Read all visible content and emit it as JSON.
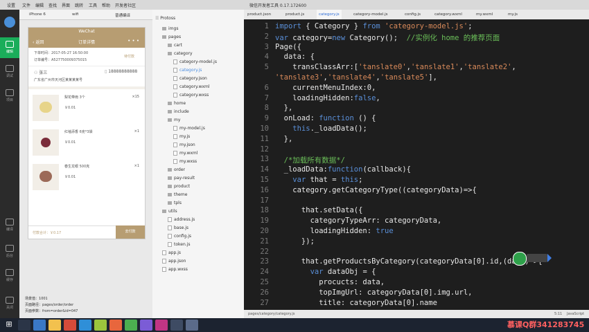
{
  "menubar": {
    "items": [
      "设置",
      "文件",
      "编辑",
      "查找",
      "界面",
      "跳转",
      "工具",
      "帮助",
      "开发者社区"
    ],
    "window_title": "微信开发者工具 0.17.172600"
  },
  "leftbar": {
    "items": [
      {
        "label": "编辑",
        "icon": "code-icon"
      },
      {
        "label": "调试",
        "icon": "bug-icon"
      },
      {
        "label": "项目",
        "icon": "project-icon"
      },
      {
        "label": "编译",
        "icon": "compile-icon"
      },
      {
        "label": "后台",
        "icon": "backend-icon"
      },
      {
        "label": "缓存",
        "icon": "cache-icon"
      },
      {
        "label": "关闭",
        "icon": "close-icon"
      }
    ]
  },
  "simulator": {
    "device": "iPhone 6",
    "network": "wifi",
    "mode": "普通编译",
    "status_title": "WeChat",
    "nav_back": "返回",
    "nav_title": "订单详情",
    "order_time_label": "下单时间：",
    "order_time": "2017-05-27 16:50:00",
    "order_no_label": "订单编号：",
    "order_no": "A527750009375015",
    "order_status": "待付款",
    "consignee": "张三",
    "phone": "18888888888",
    "address": "广东省广州市天河区某某某某号",
    "products": [
      {
        "name": "梨花带雨 3个",
        "price": "￥0.01",
        "count": "×15"
      },
      {
        "name": "红袖添香 6克*3袋",
        "price": "￥0.01",
        "count": "×1"
      },
      {
        "name": "春生龙眼 500克",
        "price": "￥0.01",
        "count": "×1"
      }
    ],
    "pay_total_label": "付款合计：",
    "pay_total": "￥0.17",
    "pay_button": "去付款",
    "page_info": [
      {
        "label": "场景值：",
        "value": "1001"
      },
      {
        "label": "页面路径：",
        "value": "pages/order/order"
      },
      {
        "label": "页面参数：",
        "value": "from=order&id=047"
      }
    ]
  },
  "filetree": {
    "project": "Protoss",
    "rows": [
      {
        "label": "imgs",
        "type": "folder",
        "level": 1
      },
      {
        "label": "pages",
        "type": "folder",
        "level": 1
      },
      {
        "label": "cart",
        "type": "folder",
        "level": 2
      },
      {
        "label": "category",
        "type": "folder",
        "level": 2
      },
      {
        "label": "category-model.js",
        "type": "file",
        "level": 3
      },
      {
        "label": "category.js",
        "type": "file",
        "level": 3,
        "active": true
      },
      {
        "label": "category.json",
        "type": "file",
        "level": 3
      },
      {
        "label": "category.wxml",
        "type": "file",
        "level": 3
      },
      {
        "label": "category.wxss",
        "type": "file",
        "level": 3
      },
      {
        "label": "home",
        "type": "folder",
        "level": 2
      },
      {
        "label": "include",
        "type": "folder",
        "level": 2
      },
      {
        "label": "my",
        "type": "folder",
        "level": 2
      },
      {
        "label": "my-model.js",
        "type": "file",
        "level": 3
      },
      {
        "label": "my.js",
        "type": "file",
        "level": 3
      },
      {
        "label": "my.json",
        "type": "file",
        "level": 3
      },
      {
        "label": "my.wxml",
        "type": "file",
        "level": 3
      },
      {
        "label": "my.wxss",
        "type": "file",
        "level": 3
      },
      {
        "label": "order",
        "type": "folder",
        "level": 2
      },
      {
        "label": "pay-result",
        "type": "folder",
        "level": 2
      },
      {
        "label": "product",
        "type": "folder",
        "level": 2
      },
      {
        "label": "theme",
        "type": "folder",
        "level": 2
      },
      {
        "label": "tpls",
        "type": "folder",
        "level": 2
      },
      {
        "label": "utils",
        "type": "folder",
        "level": 1
      },
      {
        "label": "address.js",
        "type": "file",
        "level": 2
      },
      {
        "label": "base.js",
        "type": "file",
        "level": 2
      },
      {
        "label": "config.js",
        "type": "file",
        "level": 2
      },
      {
        "label": "token.js",
        "type": "file",
        "level": 2
      },
      {
        "label": "app.js",
        "type": "file",
        "level": 1
      },
      {
        "label": "app.json",
        "type": "file",
        "level": 1
      },
      {
        "label": "app.wxss",
        "type": "file",
        "level": 1
      }
    ]
  },
  "tabs": [
    "product.json",
    "product.js",
    "category.js",
    "category-model.js",
    "config.js",
    "category.wxml",
    "my.wxml",
    "my.js"
  ],
  "active_tab": "category.js",
  "code_lines": [
    {
      "n": "1",
      "html": "<span class=\"kw\">import</span> { Category } <span class=\"kw\">from</span> <span class=\"st\">'category-model.js'</span>;"
    },
    {
      "n": "2",
      "html": "<span class=\"kw\">var</span> category=<span class=\"kw\">new</span> Category();  <span class=\"cm\">//实例化 home 的推荐页面</span>"
    },
    {
      "n": "3",
      "html": "Page({"
    },
    {
      "n": "4",
      "html": "  data: {"
    },
    {
      "n": "5",
      "html": "    transClassArr:[<span class=\"st\">'tanslate0'</span>,<span class=\"st\">'tanslate1'</span>,<span class=\"st\">'tanslate2'</span>,"
    },
    {
      "n": "",
      "html": "<span class=\"st\">'tanslate3'</span>,<span class=\"st\">'tanslate4'</span>,<span class=\"st\">'tanslate5'</span>],"
    },
    {
      "n": "6",
      "html": "    currentMenuIndex:0,"
    },
    {
      "n": "7",
      "html": "    loadingHidden:<span class=\"kw\">false</span>,"
    },
    {
      "n": "8",
      "html": "  },"
    },
    {
      "n": "9",
      "html": "  onLoad: <span class=\"kw\">function</span> () {"
    },
    {
      "n": "10",
      "html": "    <span class=\"kw\">this</span>._loadData();"
    },
    {
      "n": "11",
      "html": "  },"
    },
    {
      "n": "12",
      "html": ""
    },
    {
      "n": "13",
      "html": "  <span class=\"cm\">/*加载所有数据*/</span>"
    },
    {
      "n": "14",
      "html": "  _loadData:<span class=\"kw\">function</span>(callback){"
    },
    {
      "n": "15",
      "html": "    <span class=\"kw\">var</span> that = <span class=\"kw\">this</span>;"
    },
    {
      "n": "16",
      "html": "    category.getCategoryType((categoryData)=>{"
    },
    {
      "n": "17",
      "html": ""
    },
    {
      "n": "18",
      "html": "      that.setData({"
    },
    {
      "n": "19",
      "html": "        categoryTypeArr: categoryData,"
    },
    {
      "n": "20",
      "html": "        loadingHidden: <span class=\"kw\">true</span>"
    },
    {
      "n": "21",
      "html": "      });"
    },
    {
      "n": "22",
      "html": ""
    },
    {
      "n": "23",
      "html": "      that.getProductsByCategory(categoryData[0].id,(data)=>{"
    },
    {
      "n": "24",
      "html": "        <span class=\"kw\">var</span> dataObj = {"
    },
    {
      "n": "25",
      "html": "          procucts: data,"
    },
    {
      "n": "26",
      "html": "          topImgUrl: categoryData[0].img.url,"
    },
    {
      "n": "27",
      "html": "          title: categoryData[0].name"
    }
  ],
  "statusbar": {
    "path": "pages/category/category.js",
    "position": "5:11",
    "language": "JavaScript"
  },
  "watermark": "慕课Q群341283745",
  "colors": {
    "accent": "#b79d72",
    "editor_bg": "#1e1e1e",
    "keyword": "#5a8fd8",
    "string": "#d98a5a",
    "comment": "#6bbf59"
  }
}
